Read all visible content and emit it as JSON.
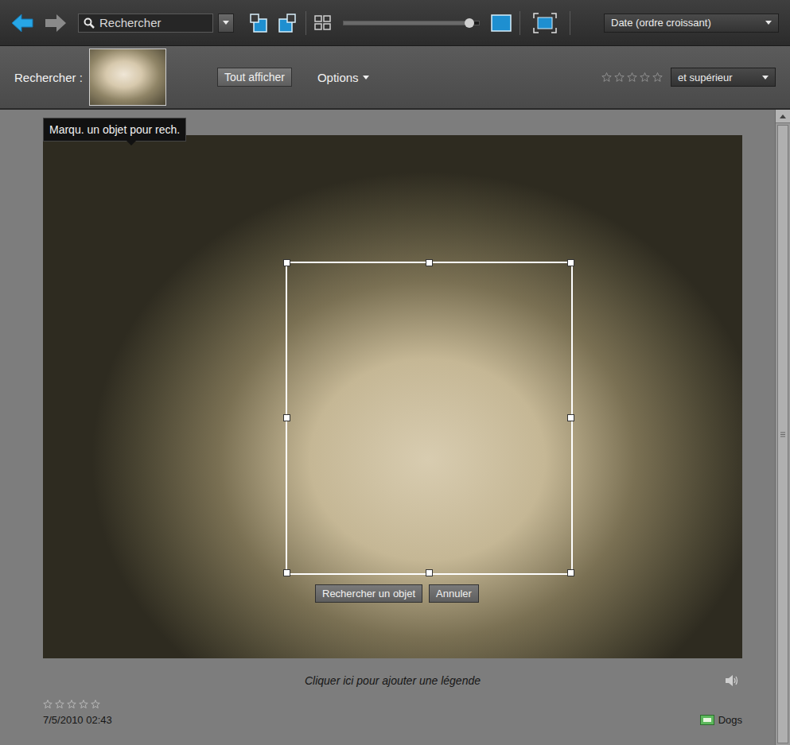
{
  "toolbar": {
    "search": {
      "label": "Rechercher"
    },
    "zoom": {
      "level": 0.93
    },
    "sort": {
      "value": "Date (ordre croissant)"
    }
  },
  "find_bar": {
    "label": "Rechercher :",
    "show_all": "Tout afficher",
    "options": "Options",
    "rating": {
      "stars": 0
    },
    "rating_filter": "et supérieur"
  },
  "tooltip": "Marqu. un objet pour rech.",
  "selection": {
    "buttons": [
      "Rechercher un objet",
      "Annuler"
    ]
  },
  "photo": {
    "caption": "Cliquer ici pour ajouter une légende",
    "stars": 0,
    "date": "7/5/2010 02:43",
    "tags": [
      {
        "label": "Dogs",
        "color": "#5cb85c"
      }
    ]
  }
}
